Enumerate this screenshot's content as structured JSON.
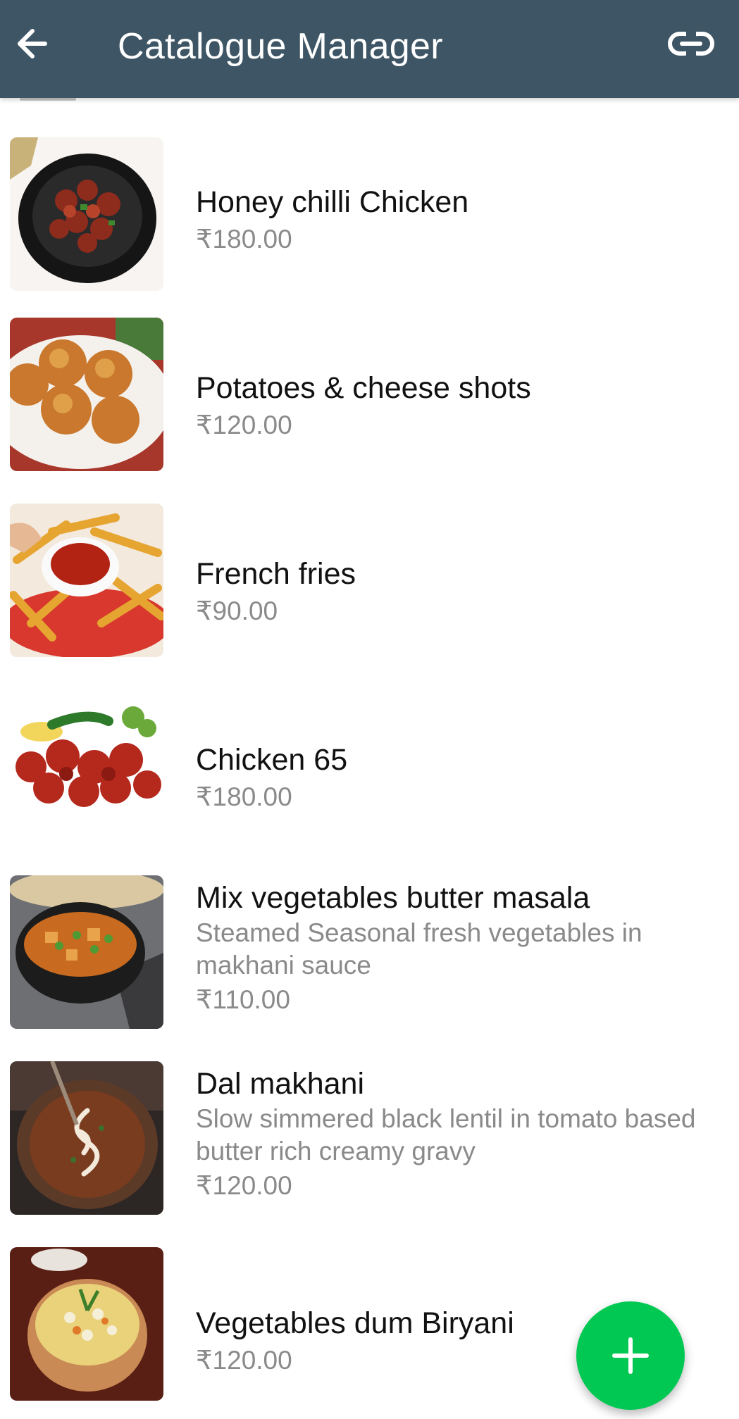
{
  "appbar": {
    "title": "Catalogue Manager",
    "back_icon": "arrow-left-icon",
    "link_icon": "link-icon",
    "color": "#3d5565"
  },
  "items": [
    {
      "name": "Honey chilli Chicken",
      "description": "",
      "price": "₹180.00",
      "image": "honey-chilli-chicken-photo"
    },
    {
      "name": "Potatoes & cheese shots",
      "description": "",
      "price": "₹120.00",
      "image": "potato-cheese-shots-photo"
    },
    {
      "name": "French fries",
      "description": "",
      "price": "₹90.00",
      "image": "french-fries-photo"
    },
    {
      "name": "Chicken 65",
      "description": "",
      "price": "₹180.00",
      "image": "chicken-65-photo"
    },
    {
      "name": "Mix vegetables butter masala",
      "description": "Steamed Seasonal fresh vegetables in makhani sauce",
      "price": "₹110.00",
      "image": "mix-veg-butter-masala-photo"
    },
    {
      "name": "Dal makhani",
      "description": "Slow simmered black lentil in tomato based butter rich creamy gravy",
      "price": "₹120.00",
      "image": "dal-makhani-photo"
    },
    {
      "name": "Vegetables dum Biryani",
      "description": "",
      "price": "₹120.00",
      "image": "veg-dum-biryani-photo"
    }
  ],
  "fab": {
    "icon": "plus-icon",
    "color": "#00c853"
  }
}
